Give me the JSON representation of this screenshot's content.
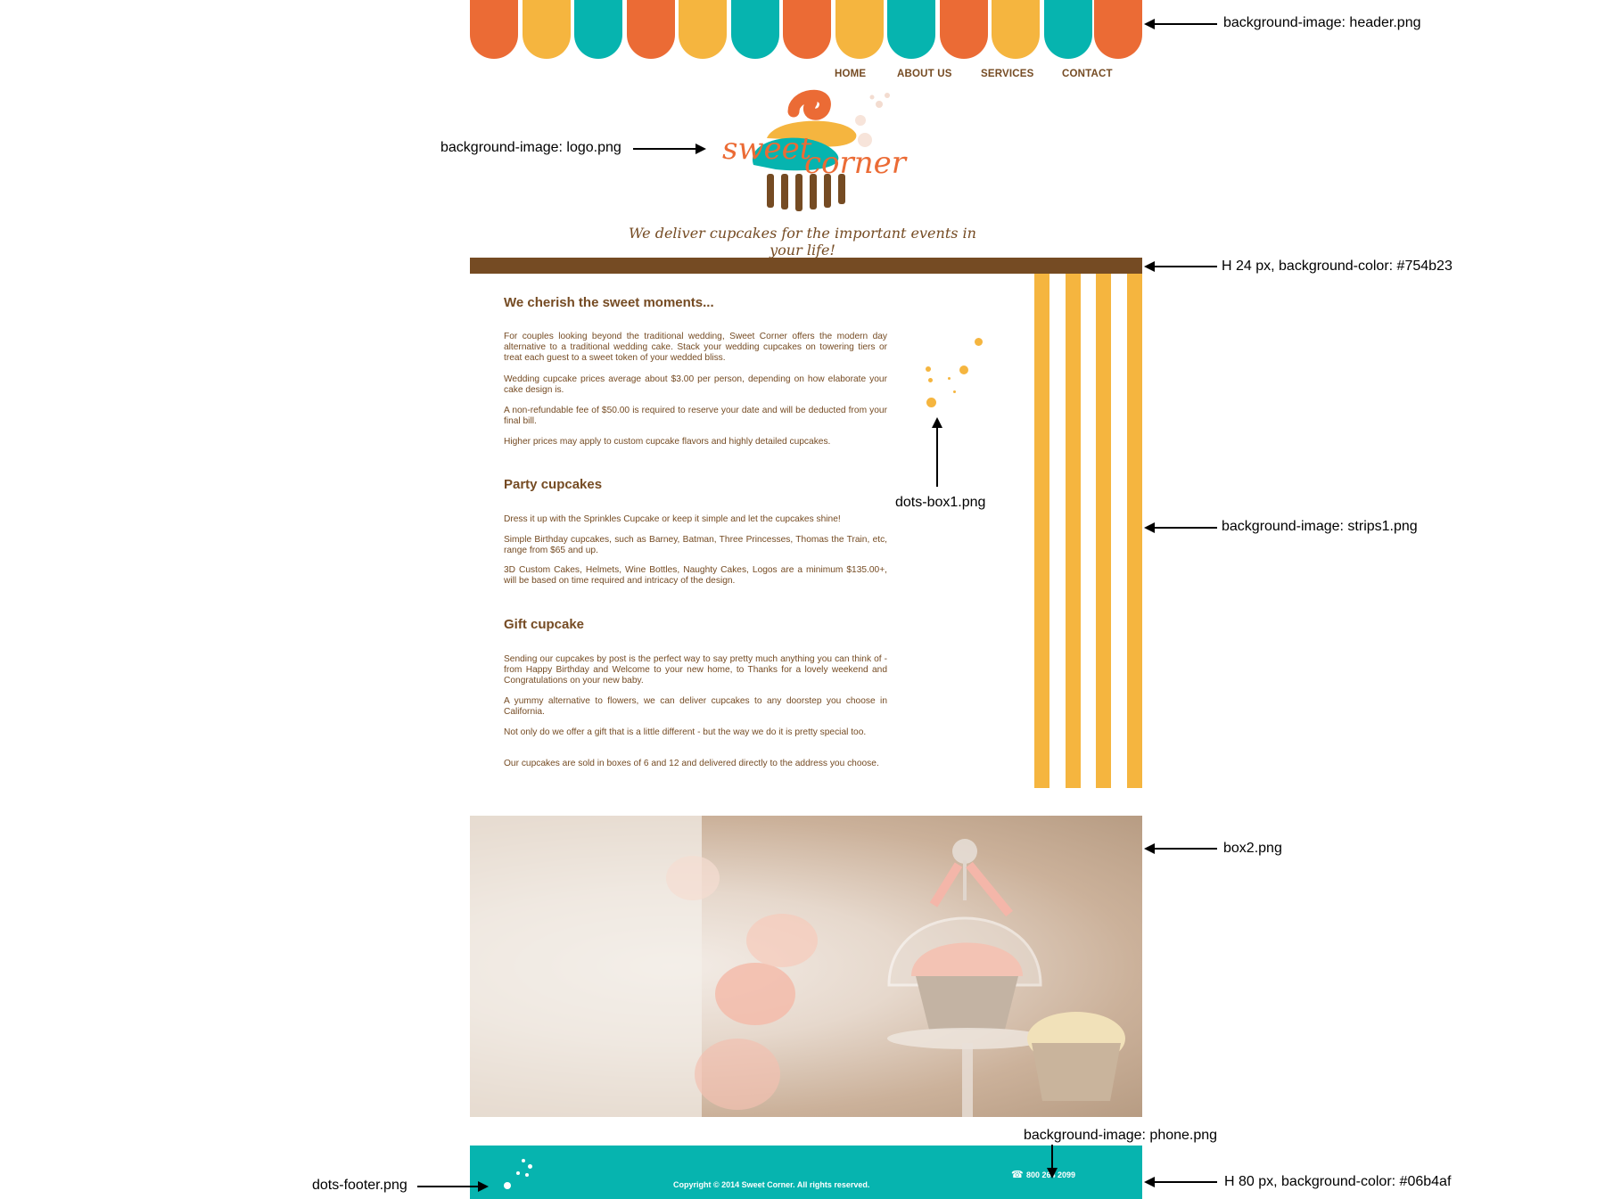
{
  "nav": {
    "items": [
      "HOME",
      "ABOUT US",
      "SERVICES",
      "CONTACT"
    ]
  },
  "logo": {
    "word1": "sweet",
    "word2": "corner"
  },
  "tagline": "We deliver cupcakes for the important events in your life!",
  "content": {
    "section1": {
      "heading": "We cherish the sweet moments...",
      "paragraphs": [
        "For couples looking beyond the traditional wedding, Sweet Corner offers the modern day alternative to a traditional wedding cake. Stack your wedding cupcakes on towering tiers or treat each guest to a sweet token of your wedded bliss.",
        "Wedding cupcake prices average about $3.00 per person, depending on how elaborate your cake design is.",
        "A non-refundable fee of $50.00 is required to reserve your date and will be deducted from your final bill.",
        "Higher prices may apply to custom cupcake flavors and highly detailed cupcakes."
      ]
    },
    "section2": {
      "heading": "Party cupcakes",
      "paragraphs": [
        "Dress it up with the Sprinkles Cupcake or keep it simple and let the cupcakes shine!",
        "Simple Birthday cupcakes, such as Barney, Batman, Three Princesses, Thomas the Train, etc, range from $65 and up.",
        "3D Custom Cakes, Helmets, Wine Bottles, Naughty Cakes, Logos are a minimum $135.00+, will be based on time required and intricacy of the design."
      ]
    },
    "section3": {
      "heading": "Gift cupcake",
      "paragraphs": [
        "Sending our cupcakes by post is the perfect way to say pretty much anything you can think of - from Happy Birthday and Welcome to your new home, to Thanks for a lovely weekend and Congratulations on your new baby.",
        "A yummy alternative to flowers, we can deliver cupcakes to any doorstep you choose in California.",
        "Not only do we offer a gift that is a little different - but the way we do it is pretty special too.",
        "Our cupcakes are sold in boxes of 6 and 12 and delivered directly to the address you choose."
      ]
    }
  },
  "footer": {
    "copyright": "Copyright © 2014 Sweet Corner. All rights reserved.",
    "phone_icon": "☎",
    "phone": "800 264 2099",
    "color": "#06b4af"
  },
  "annotations": {
    "header": "background-image: header.png",
    "logo": "background-image: logo.png",
    "bar": "H 24 px, background-color: #754b23",
    "dots_box": "dots-box1.png",
    "strips": "background-image: strips1.png",
    "box2": "box2.png",
    "phone": "background-image: phone.png",
    "dots_footer": "dots-footer.png",
    "footer": "H 80 px, background-color: #06b4af"
  },
  "colors": {
    "brown": "#754b23",
    "orange": "#eb6b35",
    "yellow": "#f5b53f",
    "teal": "#06b4af"
  }
}
